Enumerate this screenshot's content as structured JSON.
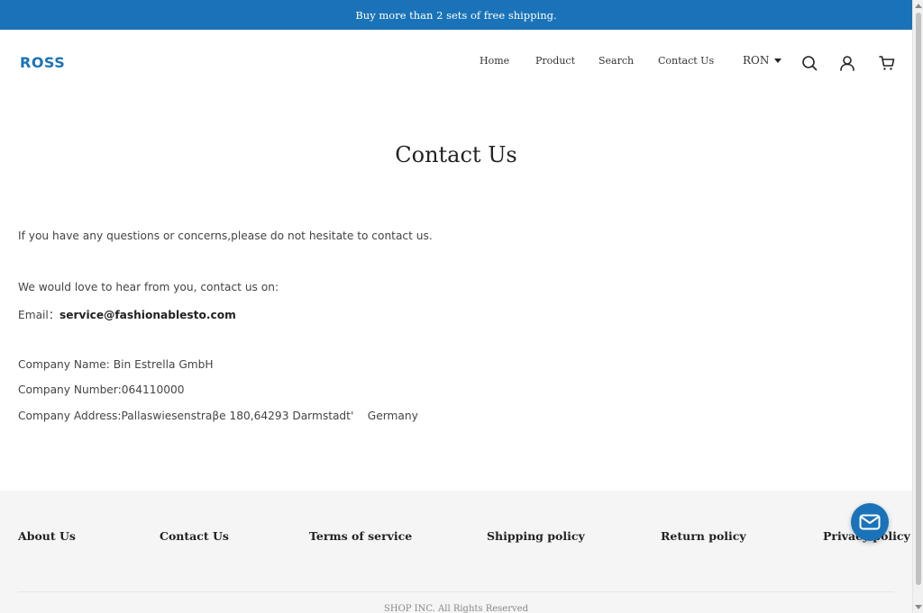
{
  "announcement": {
    "text": "Buy more than 2 sets of free shipping."
  },
  "header": {
    "logo": "ROSS",
    "nav": [
      "Home",
      "Product",
      "Search",
      "Contact Us"
    ],
    "currency": "RON",
    "icons": [
      "search-icon",
      "account-icon",
      "cart-icon"
    ]
  },
  "page": {
    "title": "Contact Us",
    "intro": "If you have any questions or concerns,please do not hesitate to contact us.",
    "love_line": "We would love to hear from you, contact us on:",
    "email_label": "Email：",
    "email_value": "service@fashionablesto.com",
    "company_name": "Company Name: Bin Estrella GmbH",
    "company_number": "Company Number:064110000",
    "company_address": "Company Address:Pallaswiesenstraβe 180,64293 Darmstadt'    Germany"
  },
  "footer": {
    "links": [
      "About Us",
      "Contact Us",
      "Terms of service",
      "Shipping policy",
      "Return policy",
      "Privacy policy"
    ],
    "copyright": "SHOP INC. All Rights Reserved"
  },
  "chat": {
    "icon": "mail-icon"
  },
  "colors": {
    "accent": "#1a73b8",
    "footer_bg": "#f5f5f5"
  }
}
